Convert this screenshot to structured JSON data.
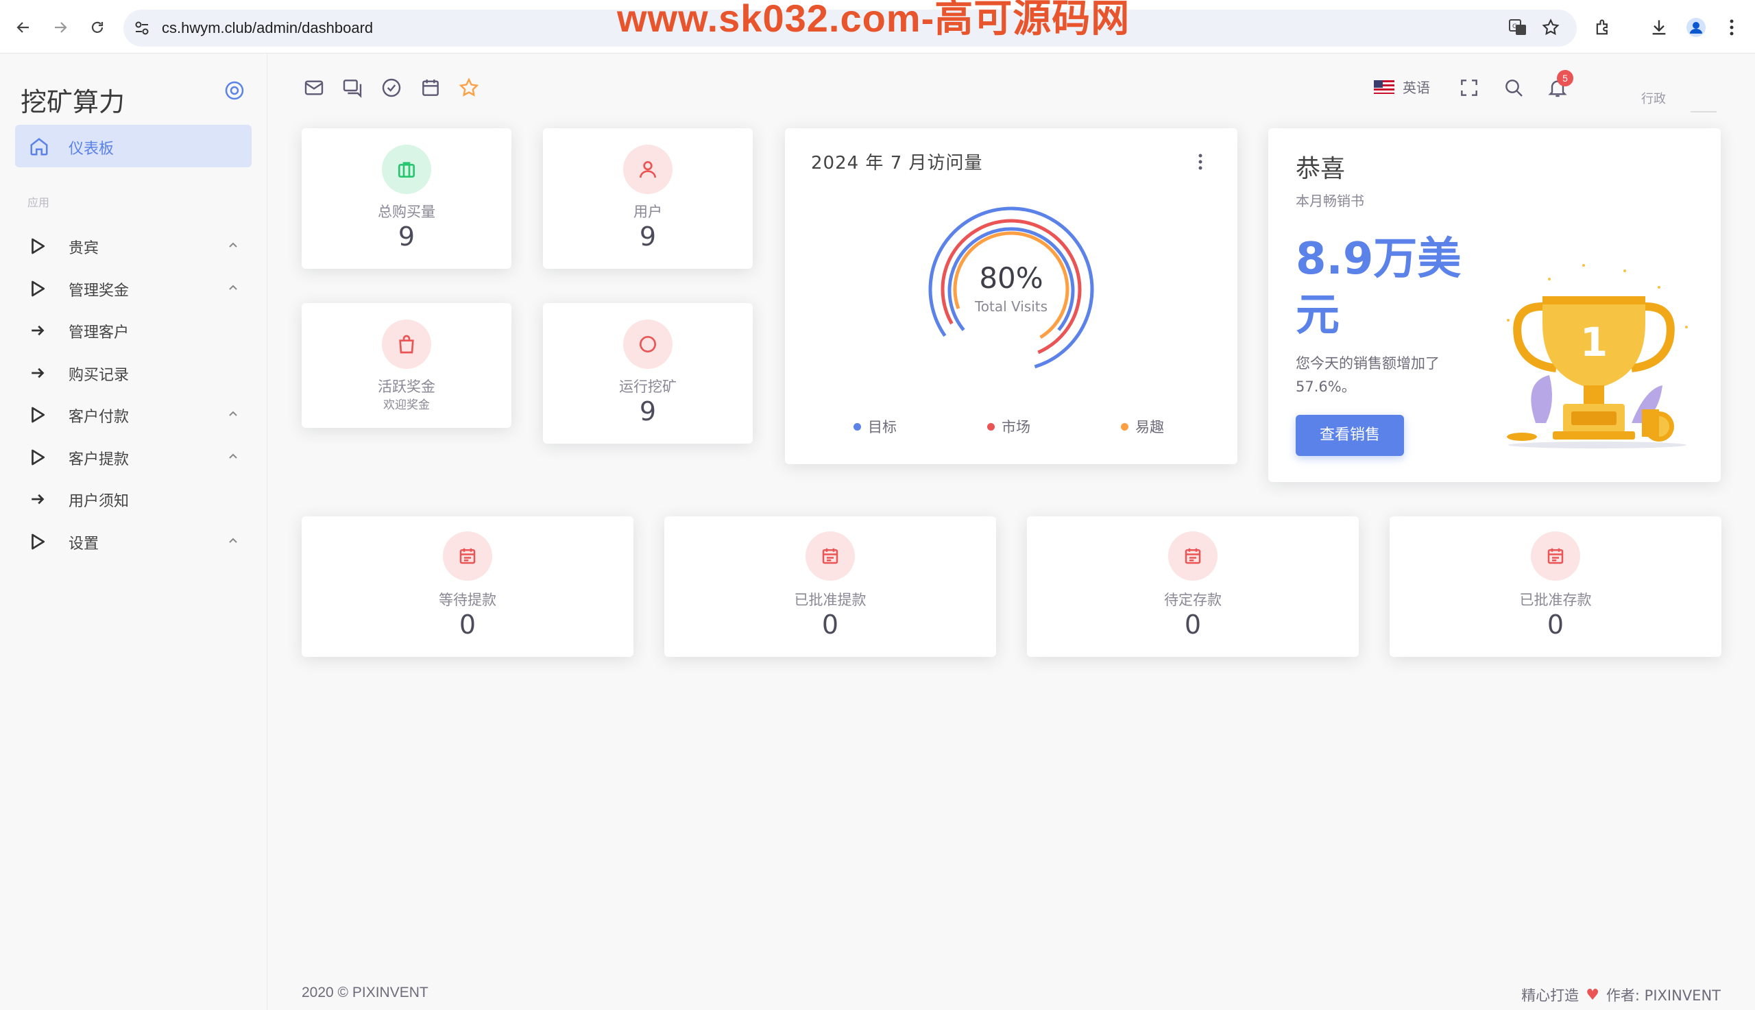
{
  "browser": {
    "url": "cs.hwym.club/admin/dashboard",
    "watermark": "www.sk032.com-高可源码网"
  },
  "sidebar": {
    "brand": "挖矿算力",
    "active_item": "仪表板",
    "section_label": "应用",
    "items": [
      {
        "label": "贵宾",
        "icon": "play-outline-icon",
        "expandable": true
      },
      {
        "label": "管理奖金",
        "icon": "play-outline-icon",
        "expandable": true
      },
      {
        "label": "管理客户",
        "icon": "arrow-right-icon",
        "expandable": false
      },
      {
        "label": "购买记录",
        "icon": "arrow-right-icon",
        "expandable": false
      },
      {
        "label": "客户付款",
        "icon": "play-outline-icon",
        "expandable": true
      },
      {
        "label": "客户提款",
        "icon": "play-outline-icon",
        "expandable": true
      },
      {
        "label": "用户须知",
        "icon": "arrow-right-icon",
        "expandable": false
      },
      {
        "label": "设置",
        "icon": "play-outline-icon",
        "expandable": true
      }
    ]
  },
  "topbar": {
    "shortcuts": [
      "mail-icon",
      "chat-icon",
      "check-circle-icon",
      "calendar-icon",
      "star-icon"
    ],
    "language": "英语",
    "notification_count": "5",
    "user_role": "行政"
  },
  "stats": {
    "total_purchases": {
      "label": "总购买量",
      "value": "9",
      "color": "#28c76f"
    },
    "users": {
      "label": "用户",
      "value": "9",
      "color": "#ea5455"
    },
    "active_bonus": {
      "label": "活跃奖金",
      "sub": "欢迎奖金",
      "color": "#ea5455"
    },
    "running_mining": {
      "label": "运行挖矿",
      "value": "9",
      "color": "#ea5455"
    }
  },
  "visits": {
    "title": "2024 年 7 月访问量",
    "percent": "80%",
    "caption": "Total Visits",
    "legend": [
      {
        "label": "目标",
        "color": "#5b82e8"
      },
      {
        "label": "市场",
        "color": "#ea5455"
      },
      {
        "label": "易趣",
        "color": "#ff9f43"
      }
    ]
  },
  "congrats": {
    "title": "恭喜",
    "subtitle": "本月畅销书",
    "amount": "8.9万美元",
    "description": "您今天的销售额增加了 57.6%。",
    "button": "查看销售",
    "trophy_rank": "1"
  },
  "transactions": [
    {
      "label": "等待提款",
      "value": "0"
    },
    {
      "label": "已批准提款",
      "value": "0"
    },
    {
      "label": "待定存款",
      "value": "0"
    },
    {
      "label": "已批准存款",
      "value": "0"
    }
  ],
  "footer": {
    "copyright": "2020 © PIXINVENT",
    "made_with": "精心打造",
    "author": "作者: PIXINVENT"
  },
  "colors": {
    "primary": "#5b82e8",
    "danger": "#ea5455",
    "success": "#28c76f",
    "warning": "#ff9f43"
  }
}
